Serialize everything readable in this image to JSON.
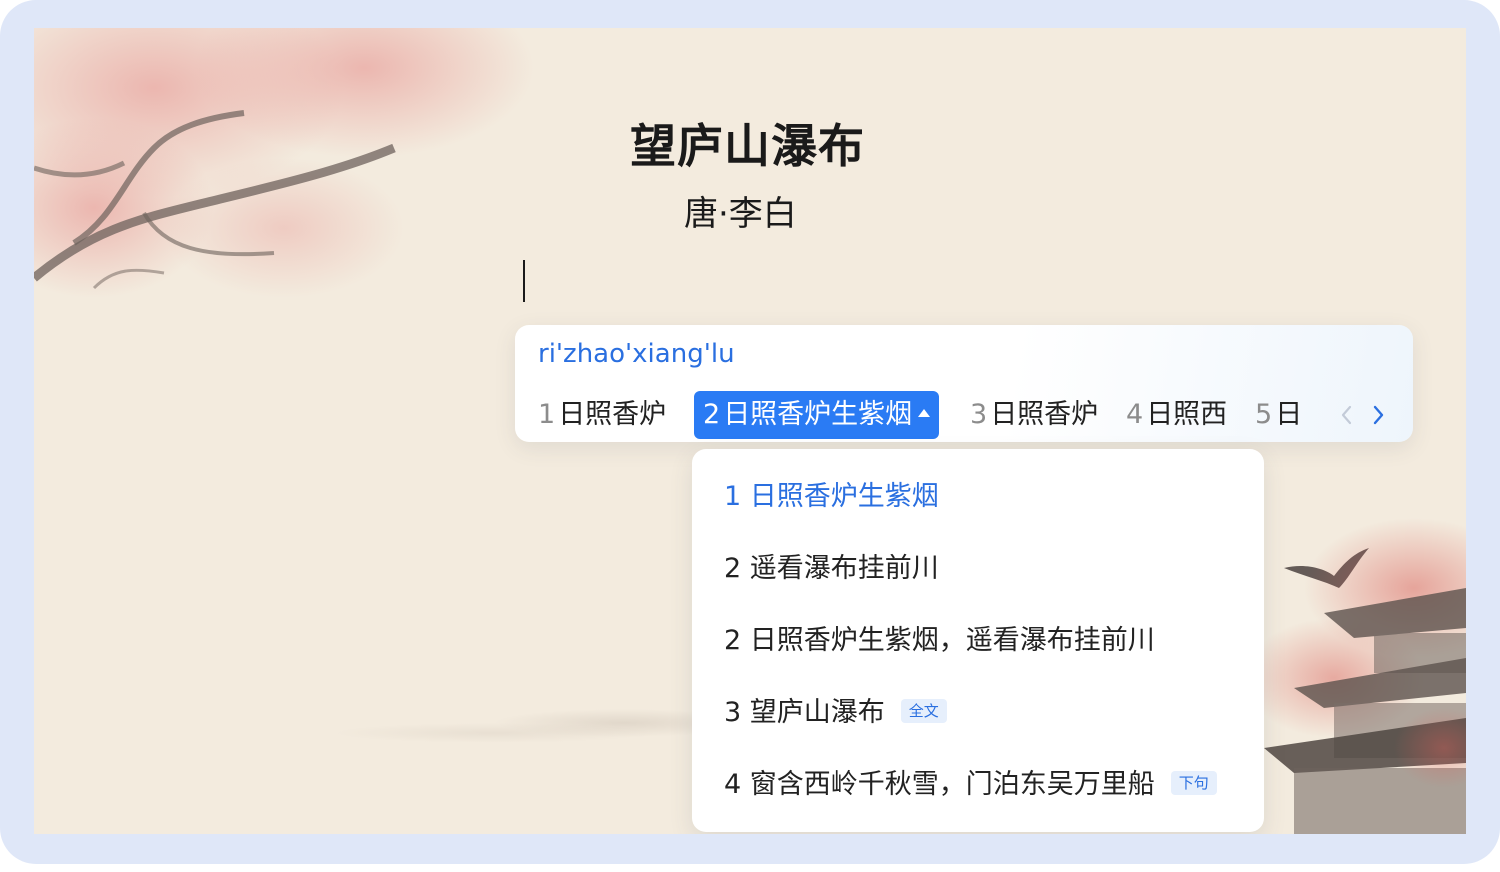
{
  "poem": {
    "title": "望庐山瀑布",
    "author": "唐·李白"
  },
  "ime": {
    "pinyin": "ri'zhao'xiang'lu",
    "candidates": [
      {
        "num": "1",
        "text": "日照香炉"
      },
      {
        "num": "2",
        "text": "日照香炉生紫烟",
        "selected": true
      },
      {
        "num": "3",
        "text": "日照香炉"
      },
      {
        "num": "4",
        "text": "日照西"
      },
      {
        "num": "5",
        "text": "日"
      }
    ],
    "prev_icon": "chevron-left-icon",
    "next_icon": "chevron-right-icon"
  },
  "dropdown": {
    "items": [
      {
        "num": "1",
        "text": "日照香炉生紫烟",
        "tag": ""
      },
      {
        "num": "2",
        "text": "遥看瀑布挂前川",
        "tag": ""
      },
      {
        "num": "2",
        "text": "日照香炉生紫烟，遥看瀑布挂前川",
        "tag": ""
      },
      {
        "num": "3",
        "text": "望庐山瀑布",
        "tag": "全文"
      },
      {
        "num": "4",
        "text": "窗含西岭千秋雪，门泊东吴万里船",
        "tag": "下句"
      }
    ]
  },
  "colors": {
    "accent": "#2a7bf4",
    "accent_text": "#2a6fe0",
    "frame": "#dfe7f8",
    "paper": "#f3ebde"
  }
}
